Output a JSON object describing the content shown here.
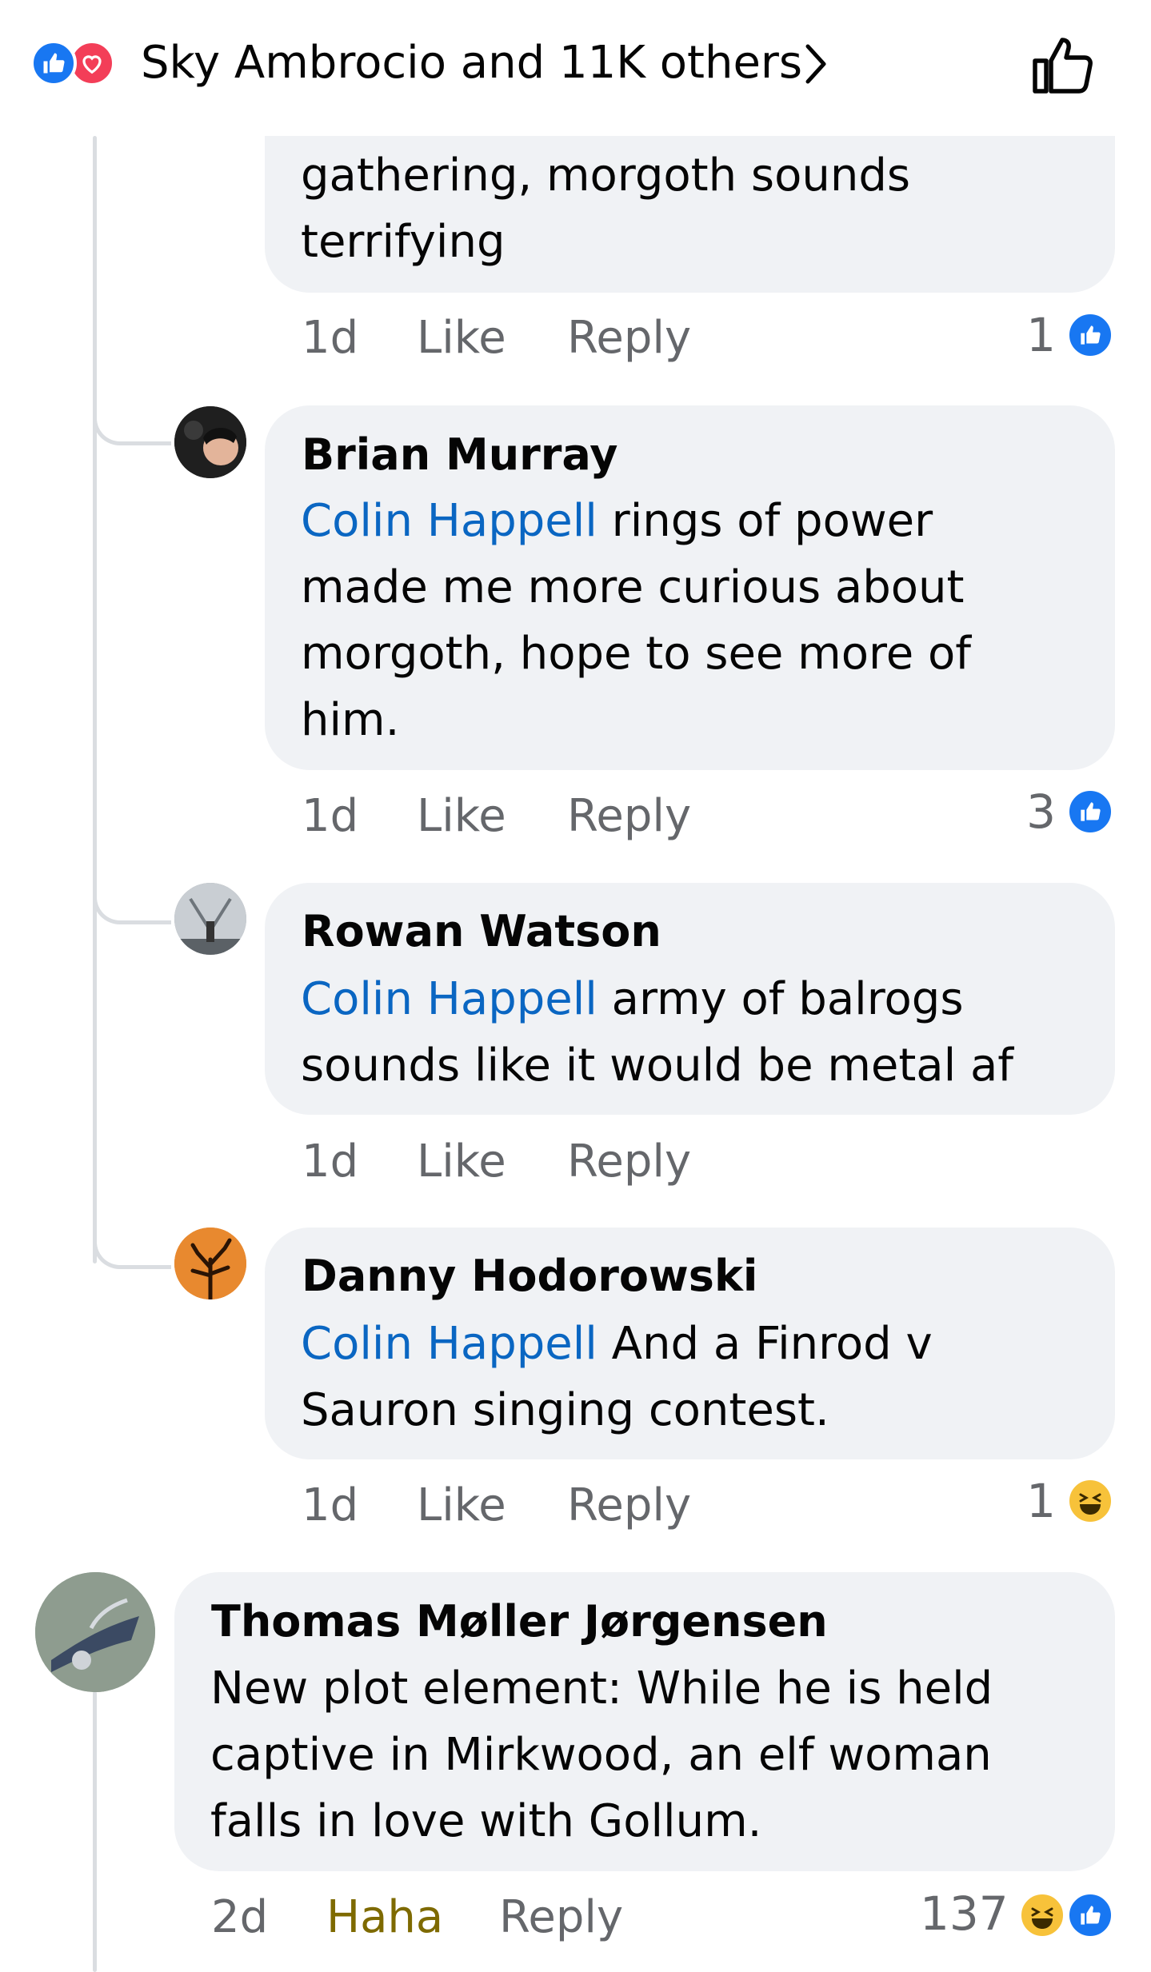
{
  "header": {
    "reactions_text": "Sky Ambrocio and 11K others",
    "icons": [
      "like-reaction-icon",
      "love-reaction-icon",
      "chevron-right-icon",
      "thumbs-up-outline-icon"
    ]
  },
  "colors": {
    "like": "#1877f2",
    "love": "#f33e58",
    "haha": "#f7c23a",
    "mention": "#0a66c2",
    "bubble": "#f0f2f5",
    "meta": "#65676b"
  },
  "comments": [
    {
      "body": "gathering, morgoth sounds\nterrifying",
      "time": "1d",
      "like": "Like",
      "reply": "Reply",
      "reaction_count": "1"
    },
    {
      "author": "Brian Murray",
      "mention": "Colin Happell",
      "body": " rings of power\nmade me more curious about\nmorgoth, hope to see more of\nhim.",
      "time": "1d",
      "like": "Like",
      "reply": "Reply",
      "reaction_count": "3"
    },
    {
      "author": "Rowan Watson",
      "mention": "Colin Happell",
      "body": " army of balrogs\nsounds like it would be metal af",
      "time": "1d",
      "like": "Like",
      "reply": "Reply"
    },
    {
      "author": "Danny Hodorowski",
      "mention": "Colin Happell",
      "body": " And a Finrod v\nSauron singing contest.",
      "time": "1d",
      "like": "Like",
      "reply": "Reply",
      "reaction_count": "1"
    },
    {
      "author": "Thomas Møller Jørgensen",
      "body": "New plot element: While he is held\ncaptive in Mirkwood, an elf woman\nfalls in love with Gollum.",
      "time": "2d",
      "like": "Haha",
      "reply": "Reply",
      "reaction_count": "137"
    }
  ]
}
